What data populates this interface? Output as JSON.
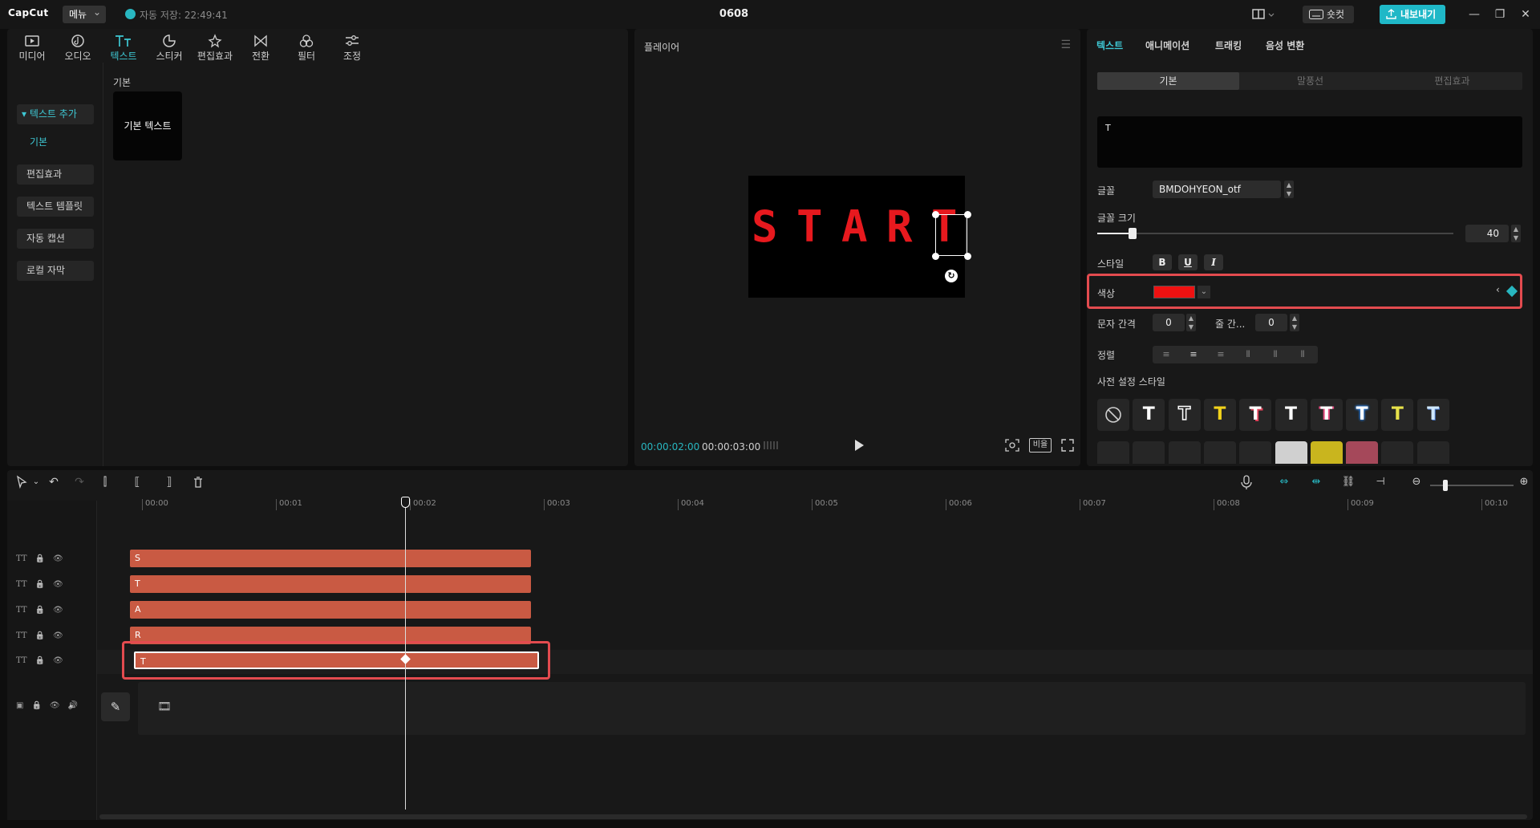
{
  "titlebar": {
    "logo": "CapCut",
    "menu_label": "메뉴",
    "autosave": "자동 저장: 22:49:41",
    "project_title": "0608",
    "shortcut_label": "숏컷",
    "export_label": "내보내기"
  },
  "left_panel": {
    "tabs": [
      {
        "label": "미디어",
        "icon": "media-icon"
      },
      {
        "label": "오디오",
        "icon": "audio-icon"
      },
      {
        "label": "텍스트",
        "icon": "text-icon",
        "active": true
      },
      {
        "label": "스티커",
        "icon": "sticker-icon"
      },
      {
        "label": "편집효과",
        "icon": "effects-icon"
      },
      {
        "label": "전환",
        "icon": "transition-icon"
      },
      {
        "label": "필터",
        "icon": "filter-icon"
      },
      {
        "label": "조정",
        "icon": "adjust-icon"
      }
    ],
    "sidebar": {
      "add_text": "텍스트 추가",
      "basic": "기본",
      "items": [
        "편집효과",
        "텍스트 템플릿",
        "자동 캡션",
        "로컬 자막"
      ]
    },
    "section_label": "기본",
    "card_label": "기본 텍스트"
  },
  "player": {
    "title": "플레이어",
    "letters": [
      "S",
      "T",
      "A",
      "R",
      "T"
    ],
    "current_time": "00:00:02:00",
    "total_time": "00:00:03:00",
    "ratio_label": "비율"
  },
  "right_panel": {
    "tabs": [
      "텍스트",
      "애니메이션",
      "트래킹",
      "음성 변환"
    ],
    "segments": [
      "기본",
      "말풍선",
      "편집효과"
    ],
    "text_value": "T",
    "font_label": "글꼴",
    "font_value": "BMDOHYEON_otf",
    "size_label": "글꼴 크기",
    "size_value": "40",
    "size_fraction": 0.1,
    "style_label": "스타일",
    "style_buttons": [
      "B",
      "U",
      "I"
    ],
    "color_label": "색상",
    "color_value": "#ee1111",
    "letter_spacing_label": "문자 간격",
    "letter_spacing_value": "0",
    "line_spacing_label": "줄 간...",
    "line_spacing_value": "0",
    "align_label": "정렬",
    "preset_label": "사전 설정 스타일",
    "presets": [
      {
        "glyph": "⃠",
        "color": "#cfcfcf"
      },
      {
        "glyph": "T",
        "color": "#ffffff"
      },
      {
        "glyph": "T",
        "color": "#ffffff"
      },
      {
        "glyph": "T",
        "color": "#f2d21b"
      },
      {
        "glyph": "T",
        "color": "#ffffff"
      },
      {
        "glyph": "T",
        "color": "#ffffff"
      },
      {
        "glyph": "T",
        "color": "#ffffff"
      },
      {
        "glyph": "T",
        "color": "#ffffff"
      },
      {
        "glyph": "T",
        "color": "#e8e24a"
      },
      {
        "glyph": "T",
        "color": "#cfe8ff"
      }
    ]
  },
  "timeline": {
    "ruler": [
      "00:00",
      "00:01",
      "00:02",
      "00:03",
      "00:04",
      "00:05",
      "00:06",
      "00:07",
      "00:08",
      "00:09",
      "00:10"
    ],
    "clips": [
      "S",
      "T",
      "A",
      "R",
      "T"
    ]
  }
}
